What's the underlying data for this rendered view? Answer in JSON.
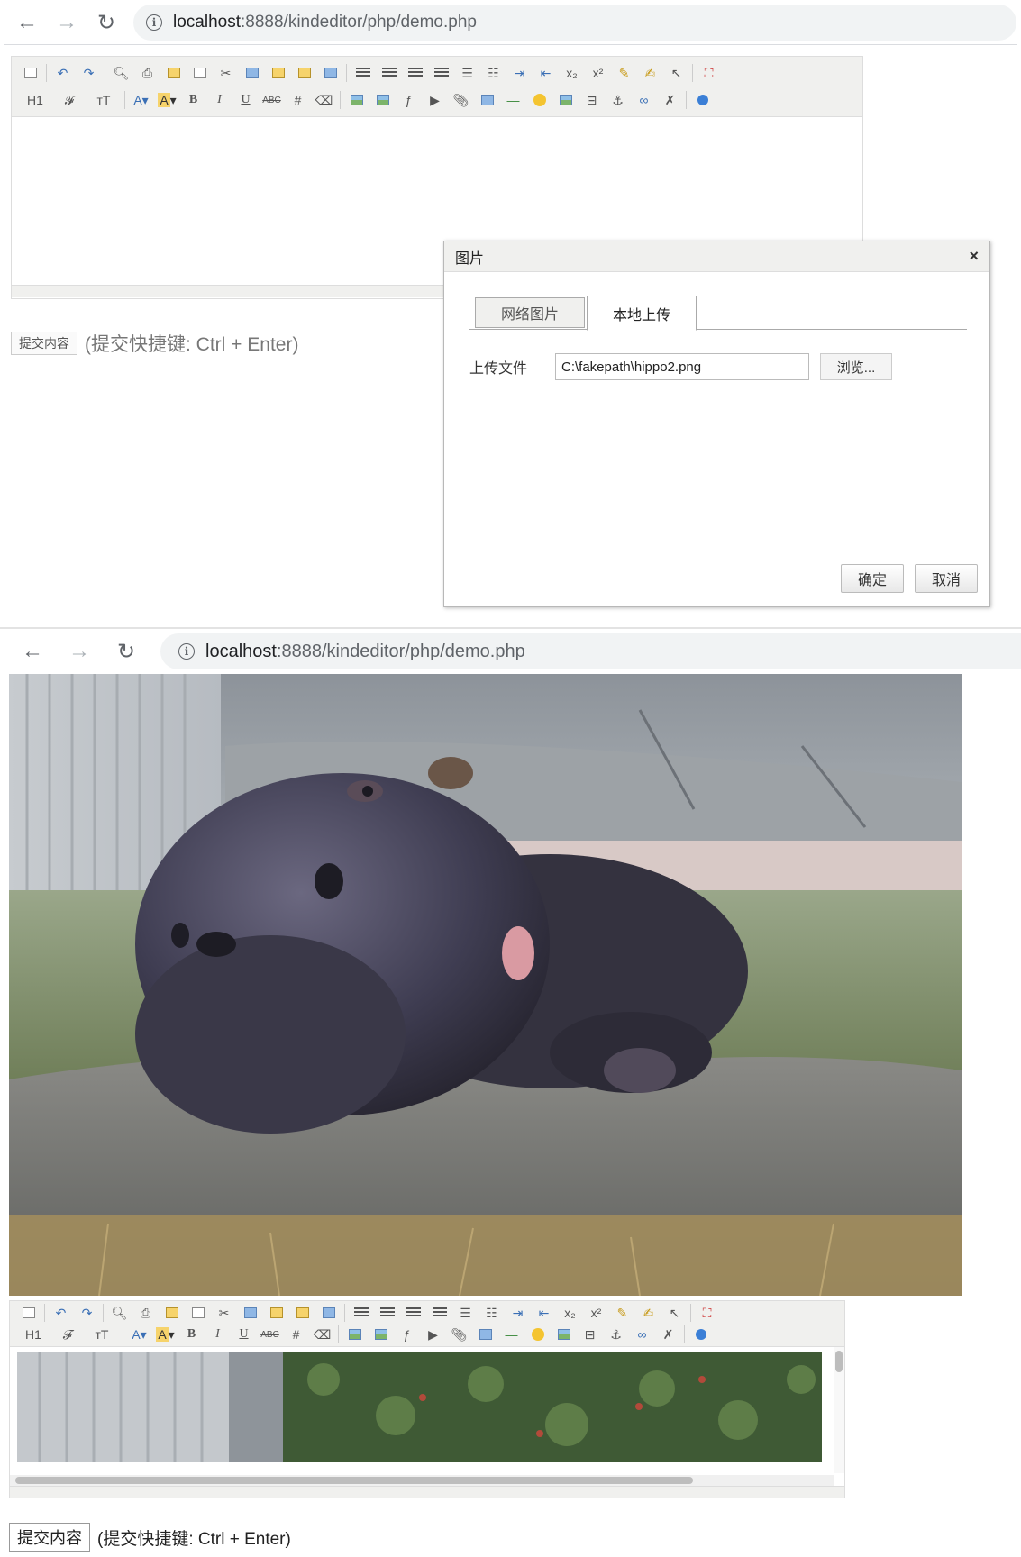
{
  "browser_top": {
    "url_host": "localhost",
    "url_path": ":8888/kindeditor/php/demo.php"
  },
  "browser_bottom": {
    "url_host": "localhost",
    "url_path": ":8888/kindeditor/php/demo.php"
  },
  "toolbar": {
    "heading_label": "H1",
    "font_label": "𝓕",
    "size_label": "тT",
    "bold_label": "B",
    "italic_label": "I",
    "underline_label": "U",
    "strike_label": "ABC"
  },
  "submit": {
    "button_label": "提交内容",
    "hint": "(提交快捷键: Ctrl + Enter)"
  },
  "dialog": {
    "title": "图片",
    "close_label": "×",
    "tab_network": "网络图片",
    "tab_local": "本地上传",
    "upload_label": "上传文件",
    "file_value": "C:\\fakepath\\hippo2.png",
    "browse_label": "浏览...",
    "ok_label": "确定",
    "cancel_label": "取消"
  },
  "colors": {
    "toolbar_bg": "#f0f0ee",
    "dialog_header_bg": "#f0f0ee",
    "url_bar_bg": "#f1f3f4"
  }
}
